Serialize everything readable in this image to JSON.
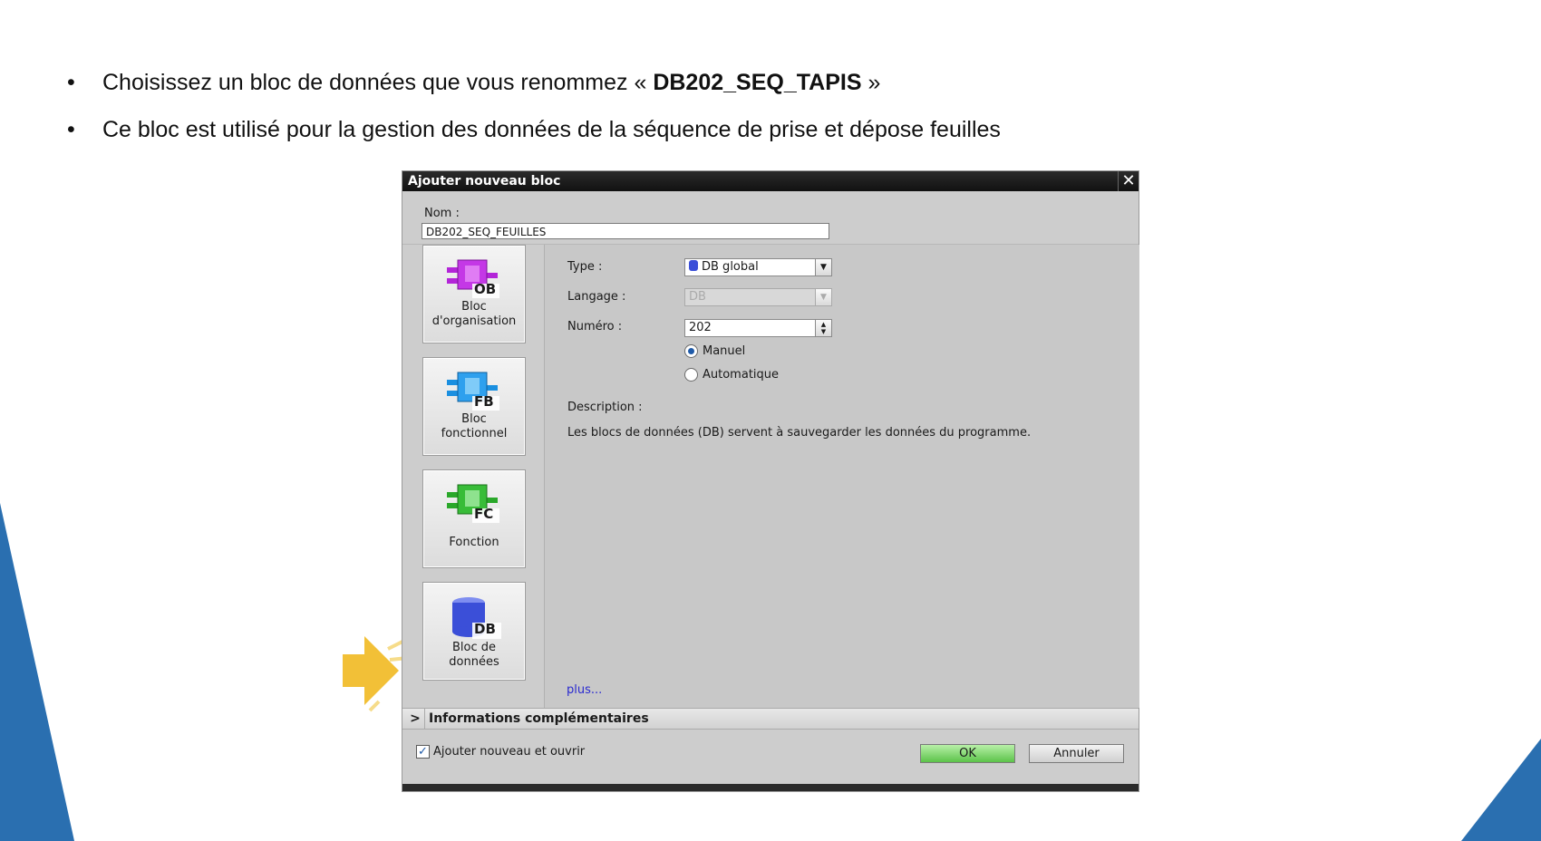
{
  "slide": {
    "bullets": [
      {
        "prefix": "Choisissez un bloc de données que vous renommez « ",
        "bold": "DB202_SEQ_TAPIS",
        "suffix": " »"
      },
      {
        "text": "Ce bloc est utilisé pour la gestion des données de la séquence de prise et dépose feuilles"
      }
    ],
    "bullet_glyph": "•",
    "accent_color": "#2a6fb0",
    "arrow_color": "#f2c037"
  },
  "dialog": {
    "title": "Ajouter nouveau bloc",
    "close_glyph": "✕",
    "name_label": "Nom :",
    "name_value": "DB202_SEQ_FEUILLES",
    "blocks": [
      {
        "icon": "ob-block-icon",
        "badge": "OB",
        "label1": "Bloc",
        "label2": "d'organisation",
        "color": "#b325d8"
      },
      {
        "icon": "fb-block-icon",
        "badge": "FB",
        "label1": "Bloc",
        "label2": "fonctionnel",
        "color": "#1a8fe0"
      },
      {
        "icon": "fc-block-icon",
        "badge": "FC",
        "label1": "Fonction",
        "label2": "",
        "color": "#2aa82a"
      },
      {
        "icon": "db-block-icon",
        "badge": "DB",
        "label1": "Bloc de",
        "label2": "données",
        "color": "#3b4fd8"
      }
    ],
    "type_label": "Type :",
    "type_value": "DB global",
    "language_label": "Langage :",
    "language_value": "DB",
    "number_label": "Numéro :",
    "number_value": "202",
    "radio_manual": "Manuel",
    "radio_auto": "Automatique",
    "description_label": "Description :",
    "description_text": "Les blocs de données (DB) servent à sauvegarder les données du programme.",
    "more_link": "plus...",
    "info_section": "Informations complémentaires",
    "add_open_label": "Ajouter nouveau et ouvrir",
    "ok_label": "OK",
    "cancel_label": "Annuler"
  }
}
